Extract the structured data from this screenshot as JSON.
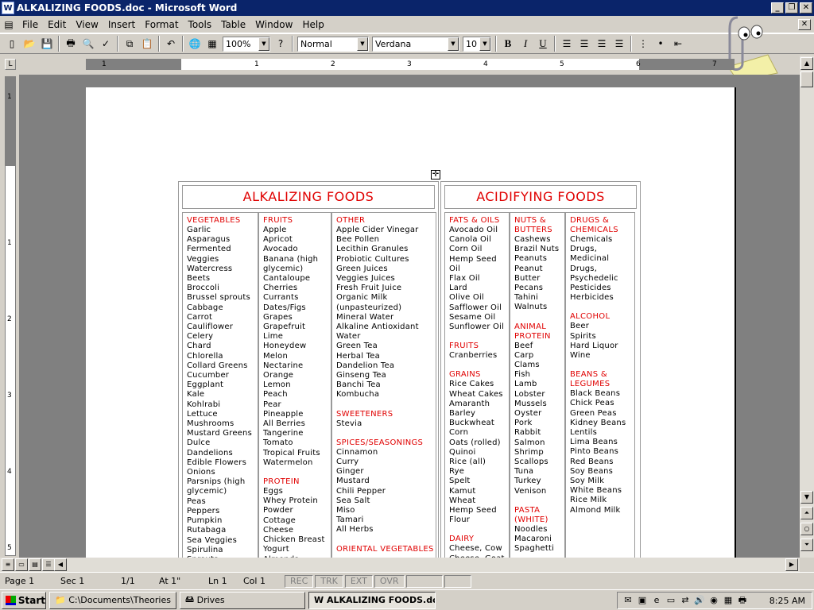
{
  "window": {
    "title": "ALKALIZING FOODS.doc - Microsoft Word",
    "app_icon": "W"
  },
  "menus": [
    "File",
    "Edit",
    "View",
    "Insert",
    "Format",
    "Tools",
    "Table",
    "Window",
    "Help"
  ],
  "toolbar": {
    "zoom": "100%",
    "style": "Normal",
    "font": "Verdana",
    "size": "10",
    "bold": "B",
    "italic": "I",
    "underline": "U"
  },
  "ruler": {
    "numbers": [
      "1",
      "1",
      "2",
      "3",
      "4",
      "5",
      "6",
      "7"
    ]
  },
  "vruler": {
    "numbers": [
      "1",
      "1",
      "2",
      "3",
      "4",
      "5"
    ]
  },
  "alkalizing": {
    "title": "ALKALIZING FOODS",
    "col1": {
      "heading": "VEGETABLES",
      "items": [
        "Garlic",
        "Asparagus",
        "Fermented",
        "Veggies",
        "Watercress",
        "Beets",
        "Broccoli",
        "Brussel sprouts",
        "Cabbage",
        "Carrot",
        "Cauliflower",
        "Celery",
        "Chard",
        "Chlorella",
        "Collard Greens",
        "Cucumber",
        "Eggplant",
        "Kale",
        "Kohlrabi",
        "Lettuce",
        "Mushrooms",
        "Mustard Greens",
        "Dulce",
        "Dandelions",
        "Edible Flowers",
        "Onions",
        "Parsnips (high",
        "glycemic)",
        "Peas",
        "Peppers",
        "Pumpkin",
        "Rutabaga",
        "Sea Veggies",
        "Spirulina",
        "Sprouts"
      ]
    },
    "col2": {
      "heading": "FRUITS",
      "items": [
        "Apple",
        "Apricot",
        "Avocado",
        "Banana (high",
        "glycemic)",
        "Cantaloupe",
        "Cherries",
        "Currants",
        "Dates/Figs",
        "Grapes",
        "Grapefruit",
        "Lime",
        "Honeydew",
        "Melon",
        "Nectarine",
        "Orange",
        "Lemon",
        "Peach",
        "Pear",
        "Pineapple",
        "All Berries",
        "Tangerine",
        "Tomato",
        "Tropical Fruits",
        "Watermelon"
      ],
      "heading2": "PROTEIN",
      "items2": [
        "Eggs",
        "Whey Protein",
        "Powder",
        "Cottage",
        "Cheese",
        "Chicken Breast",
        "Yogurt",
        "Almonds"
      ]
    },
    "col3": {
      "heading": "OTHER",
      "items": [
        "Apple Cider Vinegar",
        "Bee Pollen",
        "Lecithin Granules",
        "Probiotic Cultures",
        "Green Juices",
        "Veggies Juices",
        "Fresh Fruit Juice",
        "Organic Milk",
        "(unpasteurized)",
        "Mineral Water",
        "Alkaline Antioxidant",
        "Water",
        "Green Tea",
        "Herbal Tea",
        "Dandelion Tea",
        "Ginseng Tea",
        "Banchi Tea",
        "Kombucha"
      ],
      "heading2": "SWEETENERS",
      "items2": [
        "Stevia"
      ],
      "heading3": "SPICES/SEASONINGS",
      "items3": [
        "Cinnamon",
        "Curry",
        "Ginger",
        "Mustard",
        "Chili Pepper",
        "Sea Salt",
        "Miso",
        "Tamari",
        "All Herbs"
      ],
      "heading4": "ORIENTAL VEGETABLES"
    }
  },
  "acidifying": {
    "title": "ACIDIFYING FOODS",
    "col1": {
      "heading": "FATS & OILS",
      "items": [
        "Avocado Oil",
        "Canola Oil",
        "Corn Oil",
        "Hemp Seed",
        "Oil",
        "Flax Oil",
        "Lard",
        "Olive Oil",
        "Safflower Oil",
        "Sesame Oil",
        "Sunflower Oil"
      ],
      "heading2": "FRUITS",
      "items2": [
        "Cranberries"
      ],
      "heading3": "GRAINS",
      "items3": [
        "Rice Cakes",
        "Wheat Cakes",
        "Amaranth",
        "Barley",
        "Buckwheat",
        "Corn",
        "Oats (rolled)",
        "Quinoi",
        "Rice (all)",
        "Rye",
        "Spelt",
        "Kamut",
        "Wheat",
        "Hemp Seed",
        "Flour"
      ],
      "heading4": "DAIRY",
      "items4": [
        "Cheese, Cow",
        "Cheese, Goat"
      ]
    },
    "col2": {
      "heading": "NUTS &",
      "heading_b": "BUTTERS",
      "items": [
        "Cashews",
        "Brazil Nuts",
        "Peanuts",
        "Peanut",
        "Butter",
        "Pecans",
        "Tahini",
        "Walnuts"
      ],
      "heading2": "ANIMAL",
      "heading2_b": "PROTEIN",
      "items2": [
        "Beef",
        "Carp",
        "Clams",
        "Fish",
        "Lamb",
        "Lobster",
        "Mussels",
        "Oyster",
        "Pork",
        "Rabbit",
        "Salmon",
        "Shrimp",
        "Scallops",
        "Tuna",
        "Turkey",
        "Venison"
      ],
      "heading3": "PASTA",
      "heading3_b": "(WHITE)",
      "items3": [
        "Noodles",
        "Macaroni",
        "Spaghetti"
      ]
    },
    "col3": {
      "heading": "DRUGS &",
      "heading_b": "CHEMICALS",
      "items": [
        "Chemicals",
        "Drugs,",
        "Medicinal",
        "Drugs,",
        "Psychedelic",
        "Pesticides",
        "Herbicides"
      ],
      "heading2": "ALCOHOL",
      "items2": [
        "Beer",
        "Spirits",
        "Hard Liquor",
        "Wine"
      ],
      "heading3": "BEANS &",
      "heading3_b": "LEGUMES",
      "items3": [
        "Black Beans",
        "Chick Peas",
        "Green Peas",
        "Kidney Beans",
        "Lentils",
        "Lima Beans",
        "Pinto Beans",
        "Red Beans",
        "Soy Beans",
        "Soy Milk",
        "White Beans",
        "Rice Milk",
        "Almond Milk"
      ]
    }
  },
  "status": {
    "page": "Page 1",
    "sec": "Sec 1",
    "pages": "1/1",
    "at": "At 1\"",
    "ln": "Ln 1",
    "col": "Col 1",
    "rec": "REC",
    "trk": "TRK",
    "ext": "EXT",
    "ovr": "OVR"
  },
  "taskbar": {
    "start": "Start",
    "task1": "C:\\Documents\\Theories",
    "task2": "Drives",
    "task3": "ALKALIZING FOODS.do...",
    "clock": "8:25 AM"
  }
}
